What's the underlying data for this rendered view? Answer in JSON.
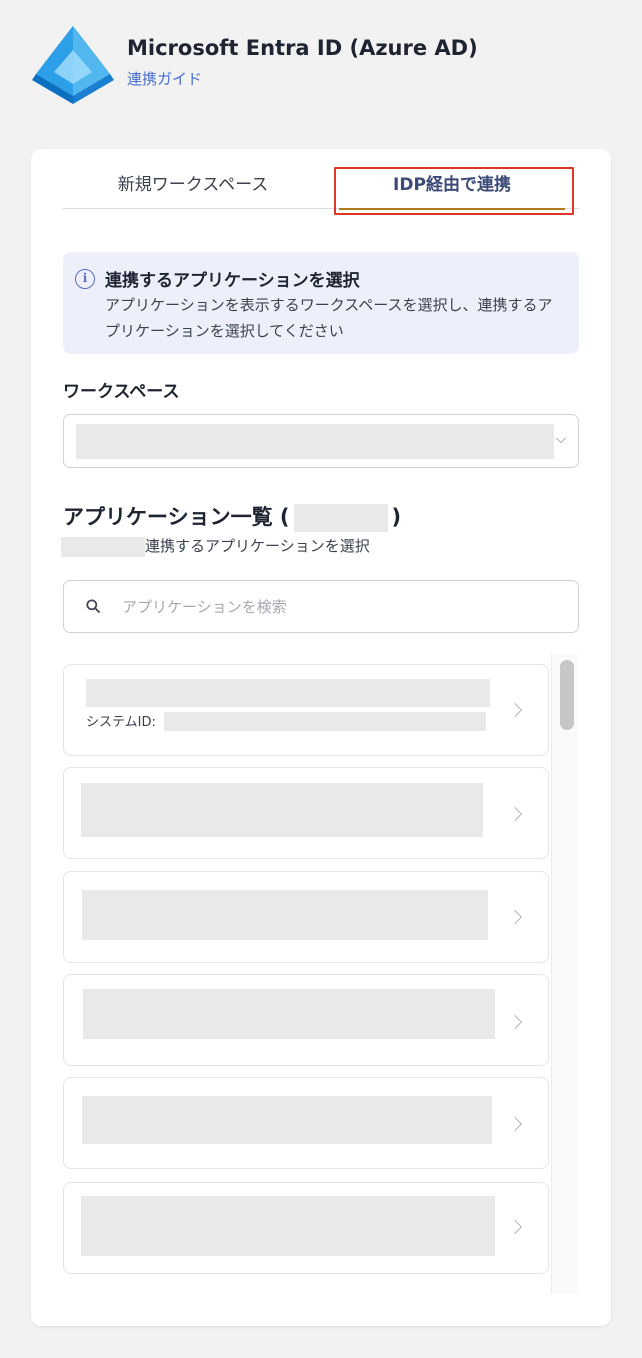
{
  "header": {
    "title": "Microsoft Entra ID (Azure AD)",
    "guide_link": "連携ガイド",
    "logo_icon": "azure-ad-pyramid-icon"
  },
  "tabs": [
    {
      "label": "新規ワークスペース",
      "active": false
    },
    {
      "label": "IDP経由で連携",
      "active": true
    }
  ],
  "info": {
    "title": "連携するアプリケーションを選択",
    "body": "アプリケーションを表示するワークスペースを選択し、連携するアプリケーションを選択してください"
  },
  "workspace": {
    "label": "ワークスペース",
    "selected_value": ""
  },
  "app_list": {
    "title_prefix": "アプリケーション一覧 (",
    "title_suffix": ")",
    "subtitle": "連携するアプリケーションを選択",
    "search_placeholder": "アプリケーションを検索",
    "system_id_label": "システムID:"
  },
  "colors": {
    "accent": "#4a6fd1",
    "tab_underline": "#b07a1f",
    "highlight_border": "#e0362a",
    "info_bg": "#edf0fb"
  }
}
